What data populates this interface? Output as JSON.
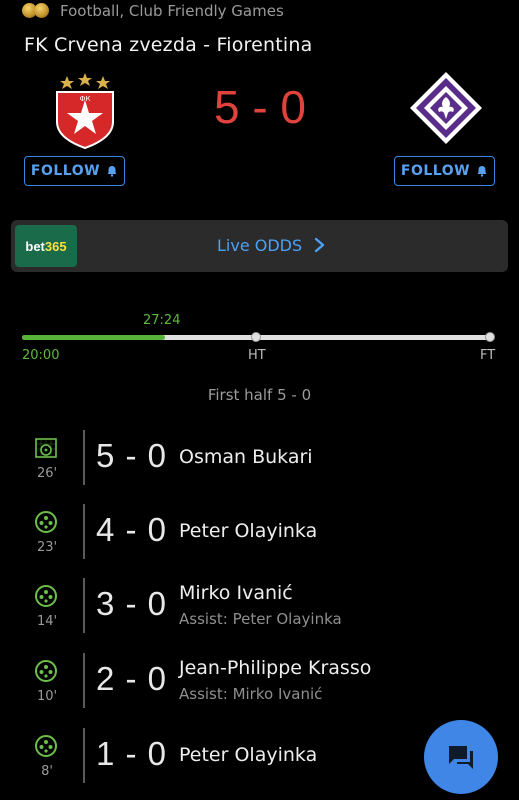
{
  "header": {
    "competition": "Football, Club Friendly Games",
    "match_title": "FK Crvena zvezda - Fiorentina",
    "score": "5 - 0",
    "home_follow": "FOLLOW",
    "away_follow": "FOLLOW"
  },
  "odds": {
    "brand_a": "bet",
    "brand_b": "365",
    "label": "Live ODDS"
  },
  "timeline": {
    "current": "27:24",
    "start": "20:00",
    "ht": "HT",
    "ft": "FT",
    "progress": 0.305
  },
  "half_summary": "First half 5 - 0",
  "events": [
    {
      "minute": "26'",
      "score": "5 - 0",
      "player": "Osman Bukari",
      "assist": "",
      "icon": "goal-net-icon"
    },
    {
      "minute": "23'",
      "score": "4 - 0",
      "player": "Peter Olayinka",
      "assist": "",
      "icon": "football-icon"
    },
    {
      "minute": "14'",
      "score": "3 - 0",
      "player": "Mirko Ivanić",
      "assist": "Assist: Peter Olayinka",
      "icon": "football-icon"
    },
    {
      "minute": "10'",
      "score": "2 - 0",
      "player": "Jean-Philippe Krasso",
      "assist": "Assist: Mirko Ivanić",
      "icon": "football-icon"
    },
    {
      "minute": "8'",
      "score": "1 - 0",
      "player": "Peter Olayinka",
      "assist": "",
      "icon": "football-icon"
    }
  ],
  "colors": {
    "accent_blue": "#3f86e6",
    "score_red": "#e0433e",
    "green": "#5fb83e"
  }
}
